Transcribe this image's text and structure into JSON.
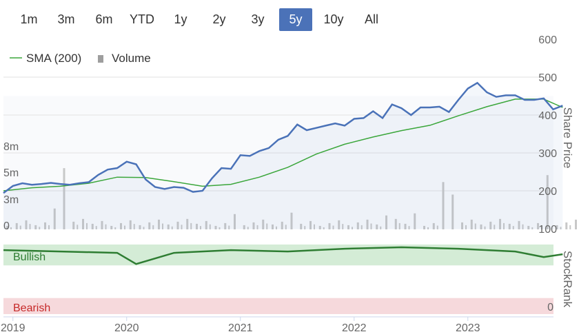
{
  "range_buttons": [
    "1m",
    "3m",
    "6m",
    "YTD",
    "1y",
    "2y",
    "3y",
    "5y",
    "10y",
    "All"
  ],
  "active_range": "5y",
  "legend": {
    "sma_label": "SMA (200)",
    "volume_label": "Volume"
  },
  "colors": {
    "price": "#4a72b8",
    "sma": "#3aa63a",
    "volume": "#c8c8c8",
    "stockrank": "#2e7d32",
    "accent": "#4b72b8"
  },
  "chart_data": [
    {
      "type": "line",
      "x_range": [
        "2018-12",
        "2023-12"
      ],
      "x_ticks": [
        "2019",
        "2020",
        "2021",
        "2022",
        "2023"
      ],
      "y_axis_title": "Share Price",
      "y_ticks": [
        100,
        200,
        300,
        400,
        500,
        600
      ],
      "ylim": [
        100,
        600
      ],
      "series": [
        {
          "name": "Share Price",
          "x": [
            "2018-12",
            "2019-01",
            "2019-02",
            "2019-03",
            "2019-04",
            "2019-05",
            "2019-06",
            "2019-07",
            "2019-08",
            "2019-09",
            "2019-10",
            "2019-11",
            "2019-12",
            "2020-01",
            "2020-02",
            "2020-03",
            "2020-04",
            "2020-05",
            "2020-06",
            "2020-07",
            "2020-08",
            "2020-09",
            "2020-10",
            "2020-11",
            "2020-12",
            "2021-01",
            "2021-02",
            "2021-03",
            "2021-04",
            "2021-05",
            "2021-06",
            "2021-07",
            "2021-08",
            "2021-09",
            "2021-10",
            "2021-11",
            "2021-12",
            "2022-01",
            "2022-02",
            "2022-03",
            "2022-04",
            "2022-05",
            "2022-06",
            "2022-07",
            "2022-08",
            "2022-09",
            "2022-10",
            "2022-11",
            "2022-12",
            "2023-01",
            "2023-02",
            "2023-03",
            "2023-04",
            "2023-05",
            "2023-06",
            "2023-07",
            "2023-08",
            "2023-09",
            "2023-10",
            "2023-11"
          ],
          "values": [
            194,
            213,
            220,
            216,
            218,
            221,
            218,
            216,
            220,
            223,
            242,
            256,
            260,
            277,
            270,
            230,
            210,
            205,
            210,
            208,
            197,
            200,
            233,
            260,
            258,
            294,
            292,
            305,
            313,
            335,
            345,
            375,
            360,
            366,
            372,
            378,
            372,
            390,
            392,
            410,
            392,
            428,
            418,
            400,
            420,
            420,
            422,
            408,
            440,
            470,
            485,
            460,
            448,
            452,
            452,
            440,
            440,
            444,
            415,
            425
          ]
        },
        {
          "name": "SMA (200)",
          "x": [
            "2018-12",
            "2019-03",
            "2019-06",
            "2019-09",
            "2019-12",
            "2020-03",
            "2020-06",
            "2020-09",
            "2020-12",
            "2021-03",
            "2021-06",
            "2021-09",
            "2021-12",
            "2022-03",
            "2022-06",
            "2022-09",
            "2022-12",
            "2023-03",
            "2023-06",
            "2023-09",
            "2023-11"
          ],
          "values": [
            200,
            208,
            212,
            220,
            236,
            235,
            224,
            212,
            217,
            236,
            262,
            297,
            323,
            342,
            359,
            373,
            398,
            422,
            442,
            442,
            420
          ]
        }
      ]
    },
    {
      "type": "bar",
      "name": "Volume",
      "y_ticks": [
        "0",
        "3m",
        "5m",
        "8m"
      ],
      "ylim": [
        0,
        10
      ],
      "spike_months": [
        "2019-05",
        "2019-06",
        "2020-12",
        "2021-06",
        "2022-04",
        "2022-07",
        "2022-10",
        "2022-11",
        "2023-09"
      ],
      "spike_values": [
        3.0,
        8.8,
        2.2,
        2.4,
        2.0,
        2.3,
        6.8,
        5.0,
        7.8
      ]
    },
    {
      "type": "area",
      "name": "StockRank",
      "y_axis_title": "StockRank",
      "zones": [
        {
          "label": "Bullish",
          "range": [
            70,
            100
          ]
        },
        {
          "label": "Bearish",
          "range": [
            0,
            30
          ]
        }
      ],
      "y_ticks": [
        0
      ],
      "ylim": [
        0,
        100
      ],
      "x": [
        "2018-12",
        "2019-06",
        "2019-12",
        "2020-02",
        "2020-06",
        "2020-12",
        "2021-06",
        "2021-12",
        "2022-06",
        "2022-12",
        "2023-06",
        "2023-09",
        "2023-11"
      ],
      "values": [
        92,
        90,
        88,
        72,
        88,
        92,
        90,
        94,
        96,
        94,
        90,
        82,
        86
      ]
    }
  ]
}
